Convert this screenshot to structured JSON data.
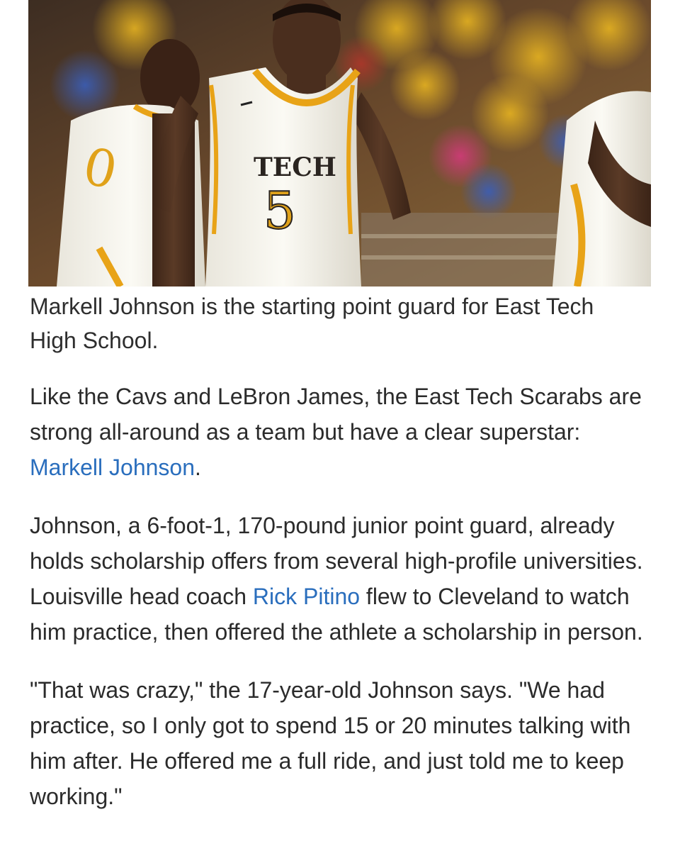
{
  "photo": {
    "jersey_text": "TECH",
    "jersey_number": "5",
    "teammate_number": "0"
  },
  "caption": "Markell Johnson is the starting point guard for East Tech High School.",
  "paragraphs": {
    "p1": {
      "before": "Like the Cavs and LeBron James, the East Tech Scarabs are strong all-around as a team but have a clear superstar: ",
      "link": "Markell Johnson",
      "after": "."
    },
    "p2": {
      "before": "Johnson, a 6-foot-1, 170-pound junior point guard, already holds scholarship offers from several high-profile universities. Louisville head coach ",
      "link": "Rick Pitino",
      "after": " flew to Cleveland to watch him practice, then offered the athlete a scholarship in person."
    },
    "p3": {
      "text": "\"That was crazy,\" the 17-year-old Johnson says. \"We had practice, so I only got to spend 15 or 20 minutes talking with him after. He offered me a full ride, and just told me to keep working.\""
    }
  },
  "colors": {
    "link": "#2a6ebd",
    "body_text": "#2b2b2b",
    "jersey_gold": "#e8a317"
  }
}
